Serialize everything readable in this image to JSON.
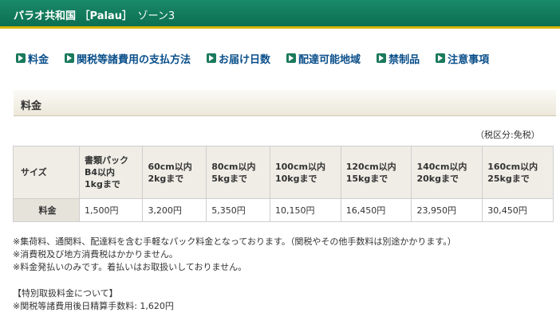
{
  "header": {
    "title": "パラオ共和国 ［Palau］",
    "zone": "ゾーン3"
  },
  "nav": [
    {
      "label": "料金"
    },
    {
      "label": "関税等諸費用の支払方法"
    },
    {
      "label": "お届け日数"
    },
    {
      "label": "配達可能地域"
    },
    {
      "label": "禁制品"
    },
    {
      "label": "注意事項"
    }
  ],
  "section": {
    "title": "料金"
  },
  "tax_note": "（税区分:免税）",
  "table": {
    "size_label": "サイズ",
    "fee_label": "料金",
    "columns": [
      {
        "size": "書類パック\nB4以内\n1kgまで",
        "fee": "1,500円"
      },
      {
        "size": "60cm以内\n2kgまで",
        "fee": "3,200円"
      },
      {
        "size": "80cm以内\n5kgまで",
        "fee": "5,350円"
      },
      {
        "size": "100cm以内\n10kgまで",
        "fee": "10,150円"
      },
      {
        "size": "120cm以内\n15kgまで",
        "fee": "16,450円"
      },
      {
        "size": "140cm以内\n20kgまで",
        "fee": "23,950円"
      },
      {
        "size": "160cm以内\n25kgまで",
        "fee": "30,450円"
      }
    ]
  },
  "notes": [
    "※集荷料、通関料、配達料を含む手軽なパック料金となっております。（関税やその他手数料は別途かかります。）",
    "※消費税及び地方消費税はかかりません。",
    "※料金発払いのみです。着払いはお取扱いしておりません。"
  ],
  "special": {
    "heading": "【特別取扱料金について】",
    "line": "※関税等諸費用後日精算手数料: 1,620円"
  }
}
